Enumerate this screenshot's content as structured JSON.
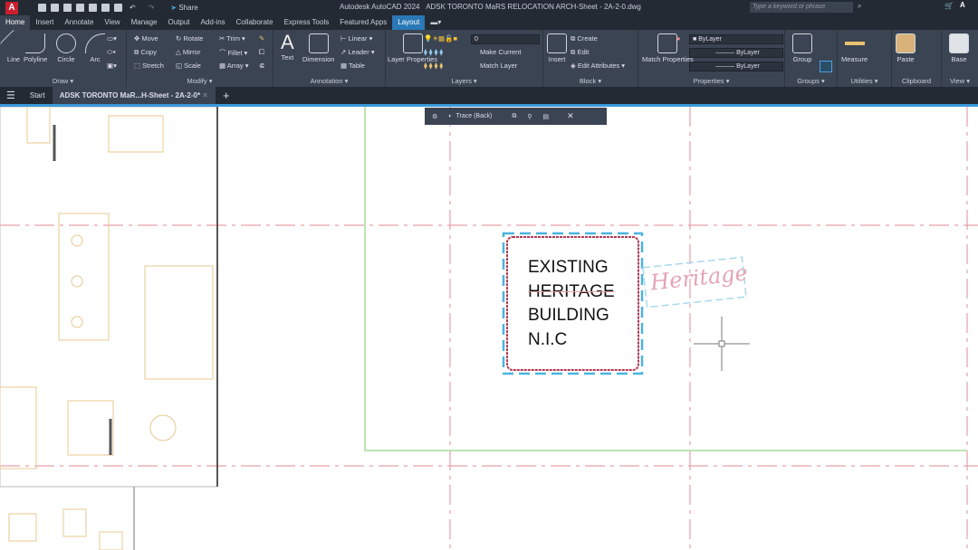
{
  "titlebar": {
    "app": "Autodesk AutoCAD 2024",
    "file": "ADSK TORONTO MaRS RELOCATION ARCH-Sheet - 2A-2-0.dwg",
    "share": "Share",
    "search_placeholder": "Type a keyword or phrase"
  },
  "tabs": [
    "Home",
    "Insert",
    "Annotate",
    "View",
    "Manage",
    "Output",
    "Add-ins",
    "Collaborate",
    "Express Tools",
    "Featured Apps",
    "Layout"
  ],
  "ribbon": {
    "draw": {
      "label": "Draw",
      "line": "Line",
      "polyline": "Polyline",
      "circle": "Circle",
      "arc": "Arc"
    },
    "modify": {
      "label": "Modify",
      "move": "Move",
      "rotate": "Rotate",
      "trim": "Trim",
      "copy": "Copy",
      "mirror": "Mirror",
      "fillet": "Fillet",
      "stretch": "Stretch",
      "scale": "Scale",
      "array": "Array"
    },
    "annotation": {
      "label": "Annotation",
      "text": "Text",
      "dimension": "Dimension",
      "linear": "Linear",
      "leader": "Leader",
      "table": "Table"
    },
    "layers": {
      "label": "Layers",
      "layer_properties": "Layer Properties",
      "current_layer": "0",
      "make_current": "Make Current",
      "match_layer": "Match Layer"
    },
    "block": {
      "label": "Block",
      "insert": "Insert",
      "create": "Create",
      "edit": "Edit",
      "edit_attributes": "Edit Attributes"
    },
    "properties": {
      "label": "Properties",
      "match_properties": "Match Properties",
      "color": "ByLayer",
      "linetype": "ByLayer",
      "lineweight": "ByLayer"
    },
    "groups": {
      "label": "Groups",
      "group": "Group"
    },
    "utilities": {
      "label": "Utilities",
      "measure": "Measure"
    },
    "clipboard": {
      "label": "Clipboard",
      "paste": "Paste"
    },
    "view": {
      "label": "View",
      "base": "Base"
    }
  },
  "doctabs": {
    "start": "Start",
    "active": "ADSK TORONTO MaR...H-Sheet - 2A-2-0*"
  },
  "trace": {
    "label": "Trace (Back)"
  },
  "drawing": {
    "note_lines": [
      "EXISTING",
      "HERITAGE",
      "BUILDING",
      "N.I.C"
    ],
    "markup": "Heritage"
  }
}
